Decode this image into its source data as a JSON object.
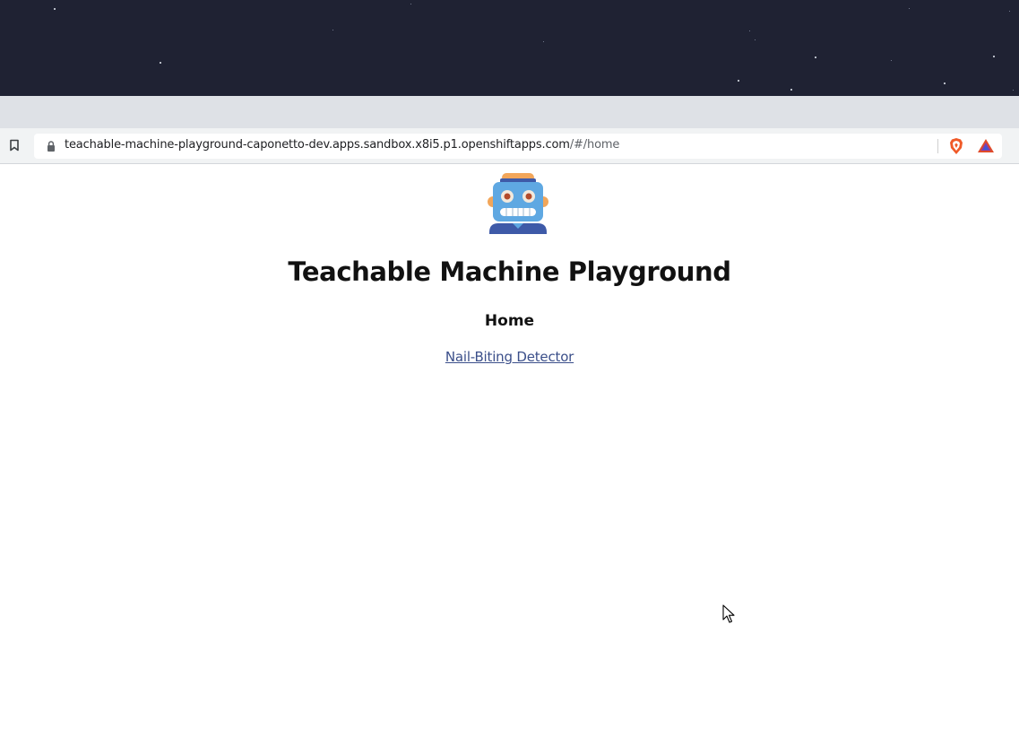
{
  "browser": {
    "url_host": "teachable-machine-playground-caponetto-dev.apps.sandbox.x8i5.p1.openshiftapps.com",
    "url_path": "/#/home",
    "icons": [
      "bookmark-icon",
      "lock-icon",
      "brave-shields-icon",
      "brave-rewards-icon"
    ]
  },
  "page": {
    "logo": "robot-icon",
    "title": "Teachable Machine Playground",
    "subtitle": "Home",
    "links": [
      {
        "label": "Nail-Biting Detector"
      }
    ]
  },
  "colors": {
    "desktop_bg": "#1f2233",
    "tabstrip_bg": "#dee1e6",
    "toolbar_bg": "#f1f3f4",
    "link": "#3b4f8a"
  }
}
